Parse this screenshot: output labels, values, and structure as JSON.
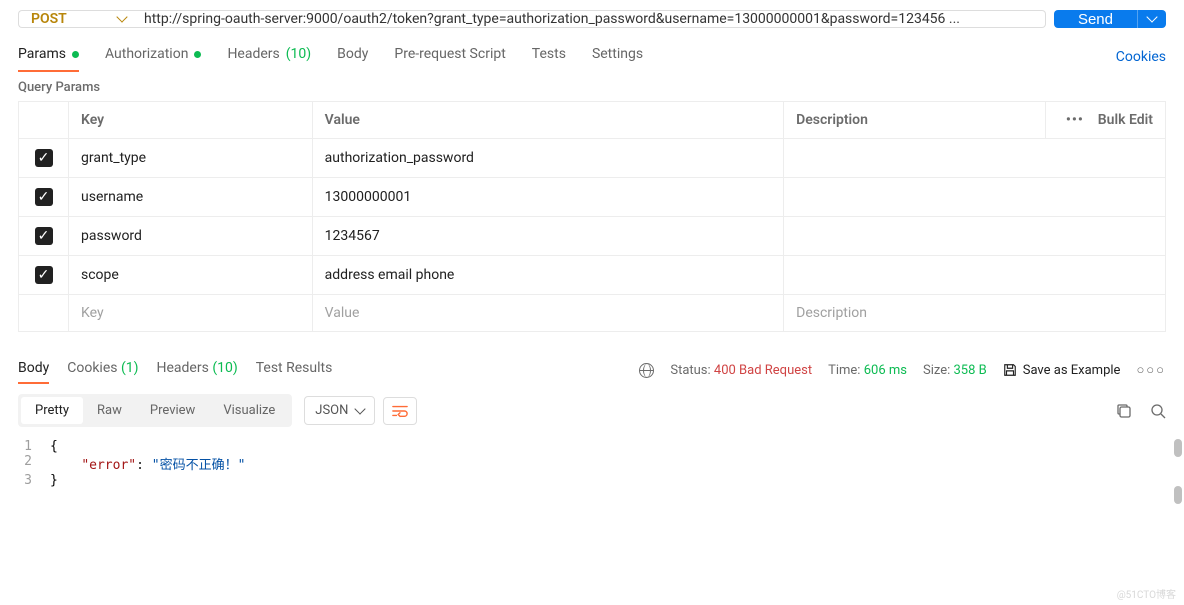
{
  "request": {
    "method": "POST",
    "url": "http://spring-oauth-server:9000/oauth2/token?grant_type=authorization_password&username=13000000001&password=123456 ...",
    "send_label": "Send"
  },
  "tabs": {
    "items": [
      {
        "label": "Params",
        "badge_dot": true
      },
      {
        "label": "Authorization",
        "badge_dot": true
      },
      {
        "label": "Headers",
        "count": "(10)"
      },
      {
        "label": "Body"
      },
      {
        "label": "Pre-request Script"
      },
      {
        "label": "Tests"
      },
      {
        "label": "Settings"
      }
    ],
    "cookies_link": "Cookies"
  },
  "query_params": {
    "section_title": "Query Params",
    "headers": {
      "key": "Key",
      "value": "Value",
      "description": "Description",
      "bulk": "Bulk Edit"
    },
    "rows": [
      {
        "enabled": true,
        "key": "grant_type",
        "value": "authorization_password",
        "description": ""
      },
      {
        "enabled": true,
        "key": "username",
        "value": "13000000001",
        "description": ""
      },
      {
        "enabled": true,
        "key": "password",
        "value": "1234567",
        "description": ""
      },
      {
        "enabled": true,
        "key": "scope",
        "value": "address email phone",
        "description": ""
      }
    ],
    "placeholder": {
      "key": "Key",
      "value": "Value",
      "description": "Description"
    }
  },
  "response": {
    "tabs": [
      {
        "label": "Body"
      },
      {
        "label": "Cookies",
        "count": "(1)"
      },
      {
        "label": "Headers",
        "count": "(10)"
      },
      {
        "label": "Test Results"
      }
    ],
    "status_label": "Status:",
    "status_value": "400 Bad Request",
    "time_label": "Time:",
    "time_value": "606 ms",
    "size_label": "Size:",
    "size_value": "358 B",
    "save_example": "Save as Example",
    "view_tabs": [
      "Pretty",
      "Raw",
      "Preview",
      "Visualize"
    ],
    "format": "JSON",
    "body_lines": [
      {
        "n": "1",
        "html": "<span class='json-brace'>{</span>"
      },
      {
        "n": "2",
        "html": "    <span class='json-key'>\"error\"</span>: <span class='json-str'>\"密码不正确！\"</span>"
      },
      {
        "n": "3",
        "html": "<span class='json-brace'>}</span>"
      }
    ]
  },
  "watermark": "@51CTO博客"
}
